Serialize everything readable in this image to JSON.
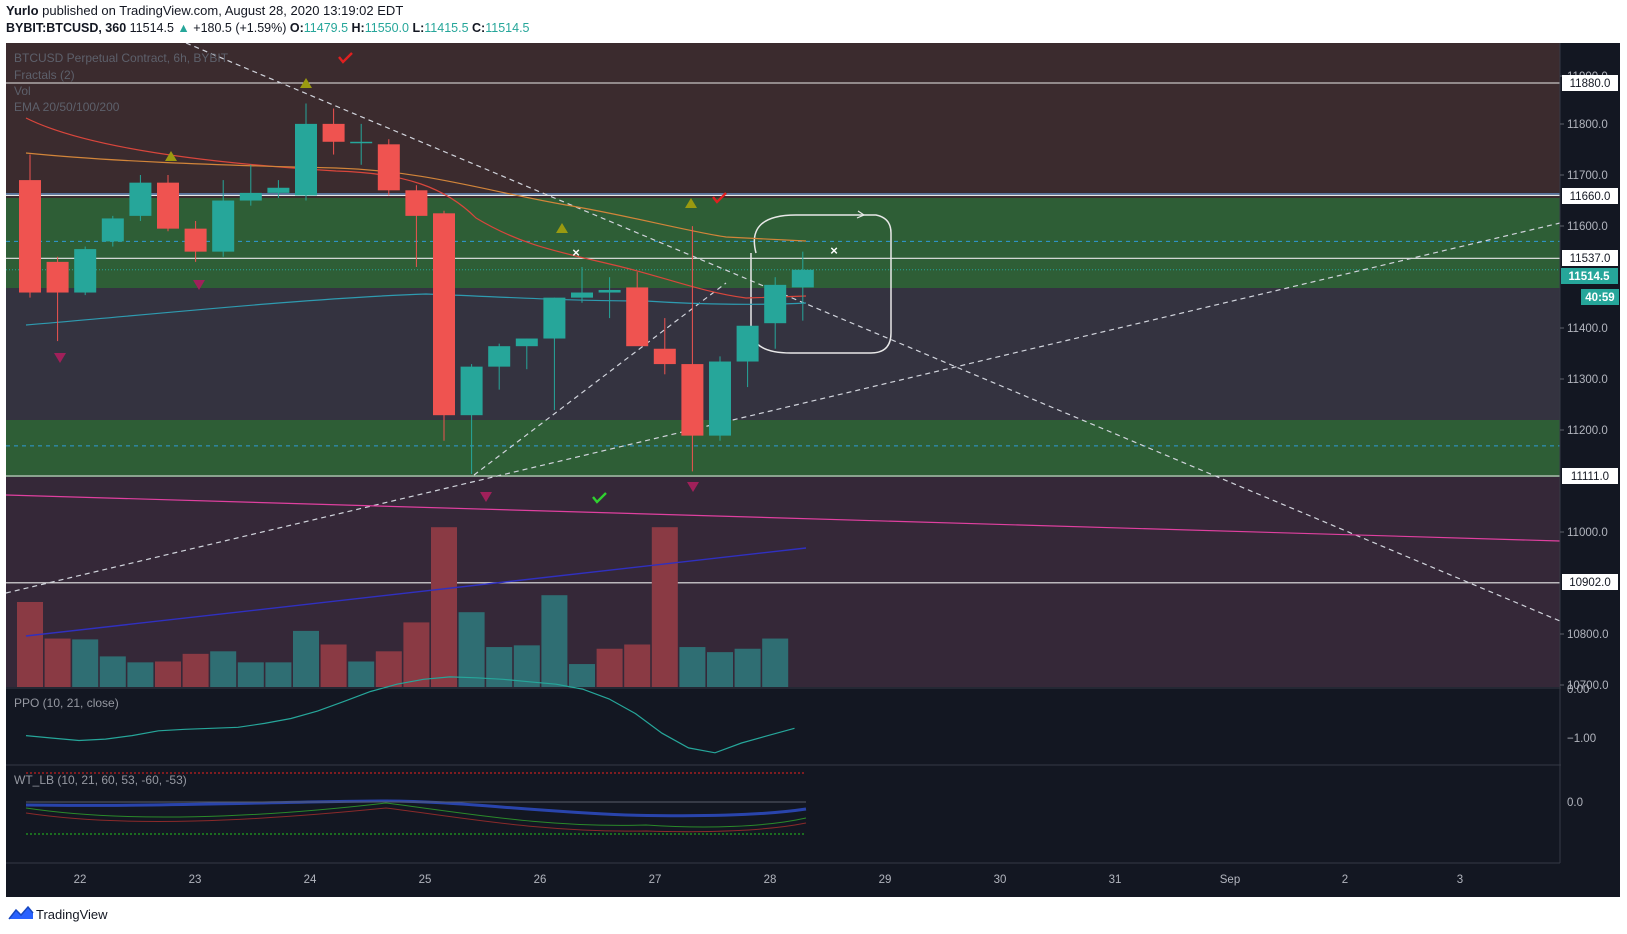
{
  "header": {
    "author": "Yurlo",
    "published": "published on TradingView.com, August 28, 2020 13:19:02 EDT",
    "symbol": "BYBIT:BTCUSD, 360",
    "last": "11514.5",
    "change": "+180.5 (+1.59%)",
    "o_label": "O:",
    "o_value": "11479.5",
    "h_label": "H:",
    "h_value": "11550.0",
    "l_label": "L:",
    "l_value": "11415.5",
    "c_label": "C:",
    "c_value": "11514.5"
  },
  "legend": {
    "title": "BTCUSD Perpetual Contract, 6h, BYBIT",
    "fractals": "Fractals (2)",
    "vol": "Vol",
    "ema": "EMA 20/50/100/200"
  },
  "footer": {
    "brand": "TradingView"
  },
  "price_axis": {
    "labels": [
      "11900.0",
      "11880.0",
      "11800.0",
      "11700.0",
      "11660.0",
      "11600.0",
      "11537.0",
      "11514.5",
      "40:59",
      "11400.0",
      "11300.0",
      "11200.0",
      "11111.0",
      "11000.0",
      "10902.0",
      "10800.0",
      "10700.0"
    ]
  },
  "colors": {
    "up": "#26a69a",
    "down": "#ef5350",
    "bg": "#131722",
    "zone_top": "#3b2b2e",
    "zone_green": "#2e5e36",
    "zone_gray": "#343340",
    "zone_purple": "#352838",
    "ema_fast": "#d9463c",
    "ema_slow": "#d2853a",
    "ema_100": "#2e9bb0"
  },
  "chart_data": [
    {
      "type": "candlestick",
      "title": "BTCUSD Perpetual Contract, 6h, BYBIT",
      "x": [
        "22",
        "23",
        "24",
        "25",
        "26",
        "27",
        "28",
        "29",
        "30",
        "31",
        "Sep",
        "2",
        "3"
      ],
      "y_ticks": [
        11800,
        11700,
        11600,
        11400,
        11300,
        11200,
        11000,
        10800
      ],
      "ylim": [
        10690,
        11920
      ],
      "horizontal_levels": [
        11880,
        11660,
        11537,
        11111,
        10902
      ],
      "last_price": 11514.5,
      "candles": [
        {
          "o": 11690,
          "h": 11740,
          "l": 11460,
          "c": 11470
        },
        {
          "o": 11530,
          "h": 11540,
          "l": 11375,
          "c": 11470
        },
        {
          "o": 11470,
          "h": 11560,
          "l": 11465,
          "c": 11555
        },
        {
          "o": 11570,
          "h": 11620,
          "l": 11560,
          "c": 11615
        },
        {
          "o": 11620,
          "h": 11700,
          "l": 11610,
          "c": 11685
        },
        {
          "o": 11685,
          "h": 11700,
          "l": 11590,
          "c": 11595
        },
        {
          "o": 11595,
          "h": 11610,
          "l": 11530,
          "c": 11550
        },
        {
          "o": 11550,
          "h": 11690,
          "l": 11540,
          "c": 11650
        },
        {
          "o": 11650,
          "h": 11720,
          "l": 11640,
          "c": 11665
        },
        {
          "o": 11665,
          "h": 11690,
          "l": 11655,
          "c": 11675
        },
        {
          "o": 11660,
          "h": 11840,
          "l": 11650,
          "c": 11800
        },
        {
          "o": 11800,
          "h": 11830,
          "l": 11740,
          "c": 11765
        },
        {
          "o": 11765,
          "h": 11800,
          "l": 11720,
          "c": 11765
        },
        {
          "o": 11760,
          "h": 11770,
          "l": 11660,
          "c": 11670
        },
        {
          "o": 11670,
          "h": 11680,
          "l": 11520,
          "c": 11620
        },
        {
          "o": 11625,
          "h": 11630,
          "l": 11180,
          "c": 11230
        },
        {
          "o": 11230,
          "h": 11330,
          "l": 11115,
          "c": 11325
        },
        {
          "o": 11325,
          "h": 11370,
          "l": 11280,
          "c": 11365
        },
        {
          "o": 11365,
          "h": 11380,
          "l": 11320,
          "c": 11380
        },
        {
          "o": 11380,
          "h": 11460,
          "l": 11240,
          "c": 11460
        },
        {
          "o": 11460,
          "h": 11520,
          "l": 11450,
          "c": 11470
        },
        {
          "o": 11470,
          "h": 11500,
          "l": 11420,
          "c": 11475
        },
        {
          "o": 11480,
          "h": 11510,
          "l": 11380,
          "c": 11365
        },
        {
          "o": 11360,
          "h": 11420,
          "l": 11310,
          "c": 11330
        },
        {
          "o": 11330,
          "h": 11600,
          "l": 11120,
          "c": 11190
        },
        {
          "o": 11190,
          "h": 11345,
          "l": 11180,
          "c": 11335
        },
        {
          "o": 11335,
          "h": 11370,
          "l": 11285,
          "c": 11405
        },
        {
          "o": 11410,
          "h": 11500,
          "l": 11360,
          "c": 11485
        },
        {
          "o": 11480,
          "h": 11550,
          "l": 11415,
          "c": 11514.5
        }
      ],
      "volume": [
        {
          "v": 1.0,
          "dir": "down"
        },
        {
          "v": 0.57,
          "dir": "down"
        },
        {
          "v": 0.56,
          "dir": "up"
        },
        {
          "v": 0.36,
          "dir": "up"
        },
        {
          "v": 0.29,
          "dir": "up"
        },
        {
          "v": 0.3,
          "dir": "down"
        },
        {
          "v": 0.39,
          "dir": "down"
        },
        {
          "v": 0.42,
          "dir": "up"
        },
        {
          "v": 0.29,
          "dir": "up"
        },
        {
          "v": 0.29,
          "dir": "up"
        },
        {
          "v": 0.66,
          "dir": "up"
        },
        {
          "v": 0.5,
          "dir": "down"
        },
        {
          "v": 0.3,
          "dir": "up"
        },
        {
          "v": 0.42,
          "dir": "down"
        },
        {
          "v": 0.76,
          "dir": "down"
        },
        {
          "v": 1.88,
          "dir": "down"
        },
        {
          "v": 0.88,
          "dir": "up"
        },
        {
          "v": 0.47,
          "dir": "up"
        },
        {
          "v": 0.49,
          "dir": "up"
        },
        {
          "v": 1.08,
          "dir": "up"
        },
        {
          "v": 0.27,
          "dir": "up"
        },
        {
          "v": 0.45,
          "dir": "down"
        },
        {
          "v": 0.5,
          "dir": "down"
        },
        {
          "v": 1.88,
          "dir": "down"
        },
        {
          "v": 0.47,
          "dir": "up"
        },
        {
          "v": 0.41,
          "dir": "up"
        },
        {
          "v": 0.45,
          "dir": "up"
        },
        {
          "v": 0.57,
          "dir": "up"
        }
      ]
    },
    {
      "type": "line",
      "title": "PPO (10, 21, close)",
      "y_ticks": [
        "0.00",
        "−1.00"
      ],
      "ylim": [
        -1.6,
        0.15
      ],
      "values": [
        -0.85,
        -0.9,
        -0.95,
        -0.92,
        -0.85,
        -0.75,
        -0.72,
        -0.7,
        -0.68,
        -0.6,
        -0.5,
        -0.35,
        -0.15,
        0.05,
        0.2,
        0.3,
        0.35,
        0.33,
        0.3,
        0.25,
        0.2,
        0.1,
        -0.1,
        -0.4,
        -0.8,
        -1.1,
        -1.2,
        -1.0,
        -0.85,
        -0.7
      ]
    },
    {
      "type": "line",
      "title": "WT_LB (10, 21, 60, 53, -60, -53)",
      "y_ticks": [
        "0.0"
      ]
    }
  ]
}
